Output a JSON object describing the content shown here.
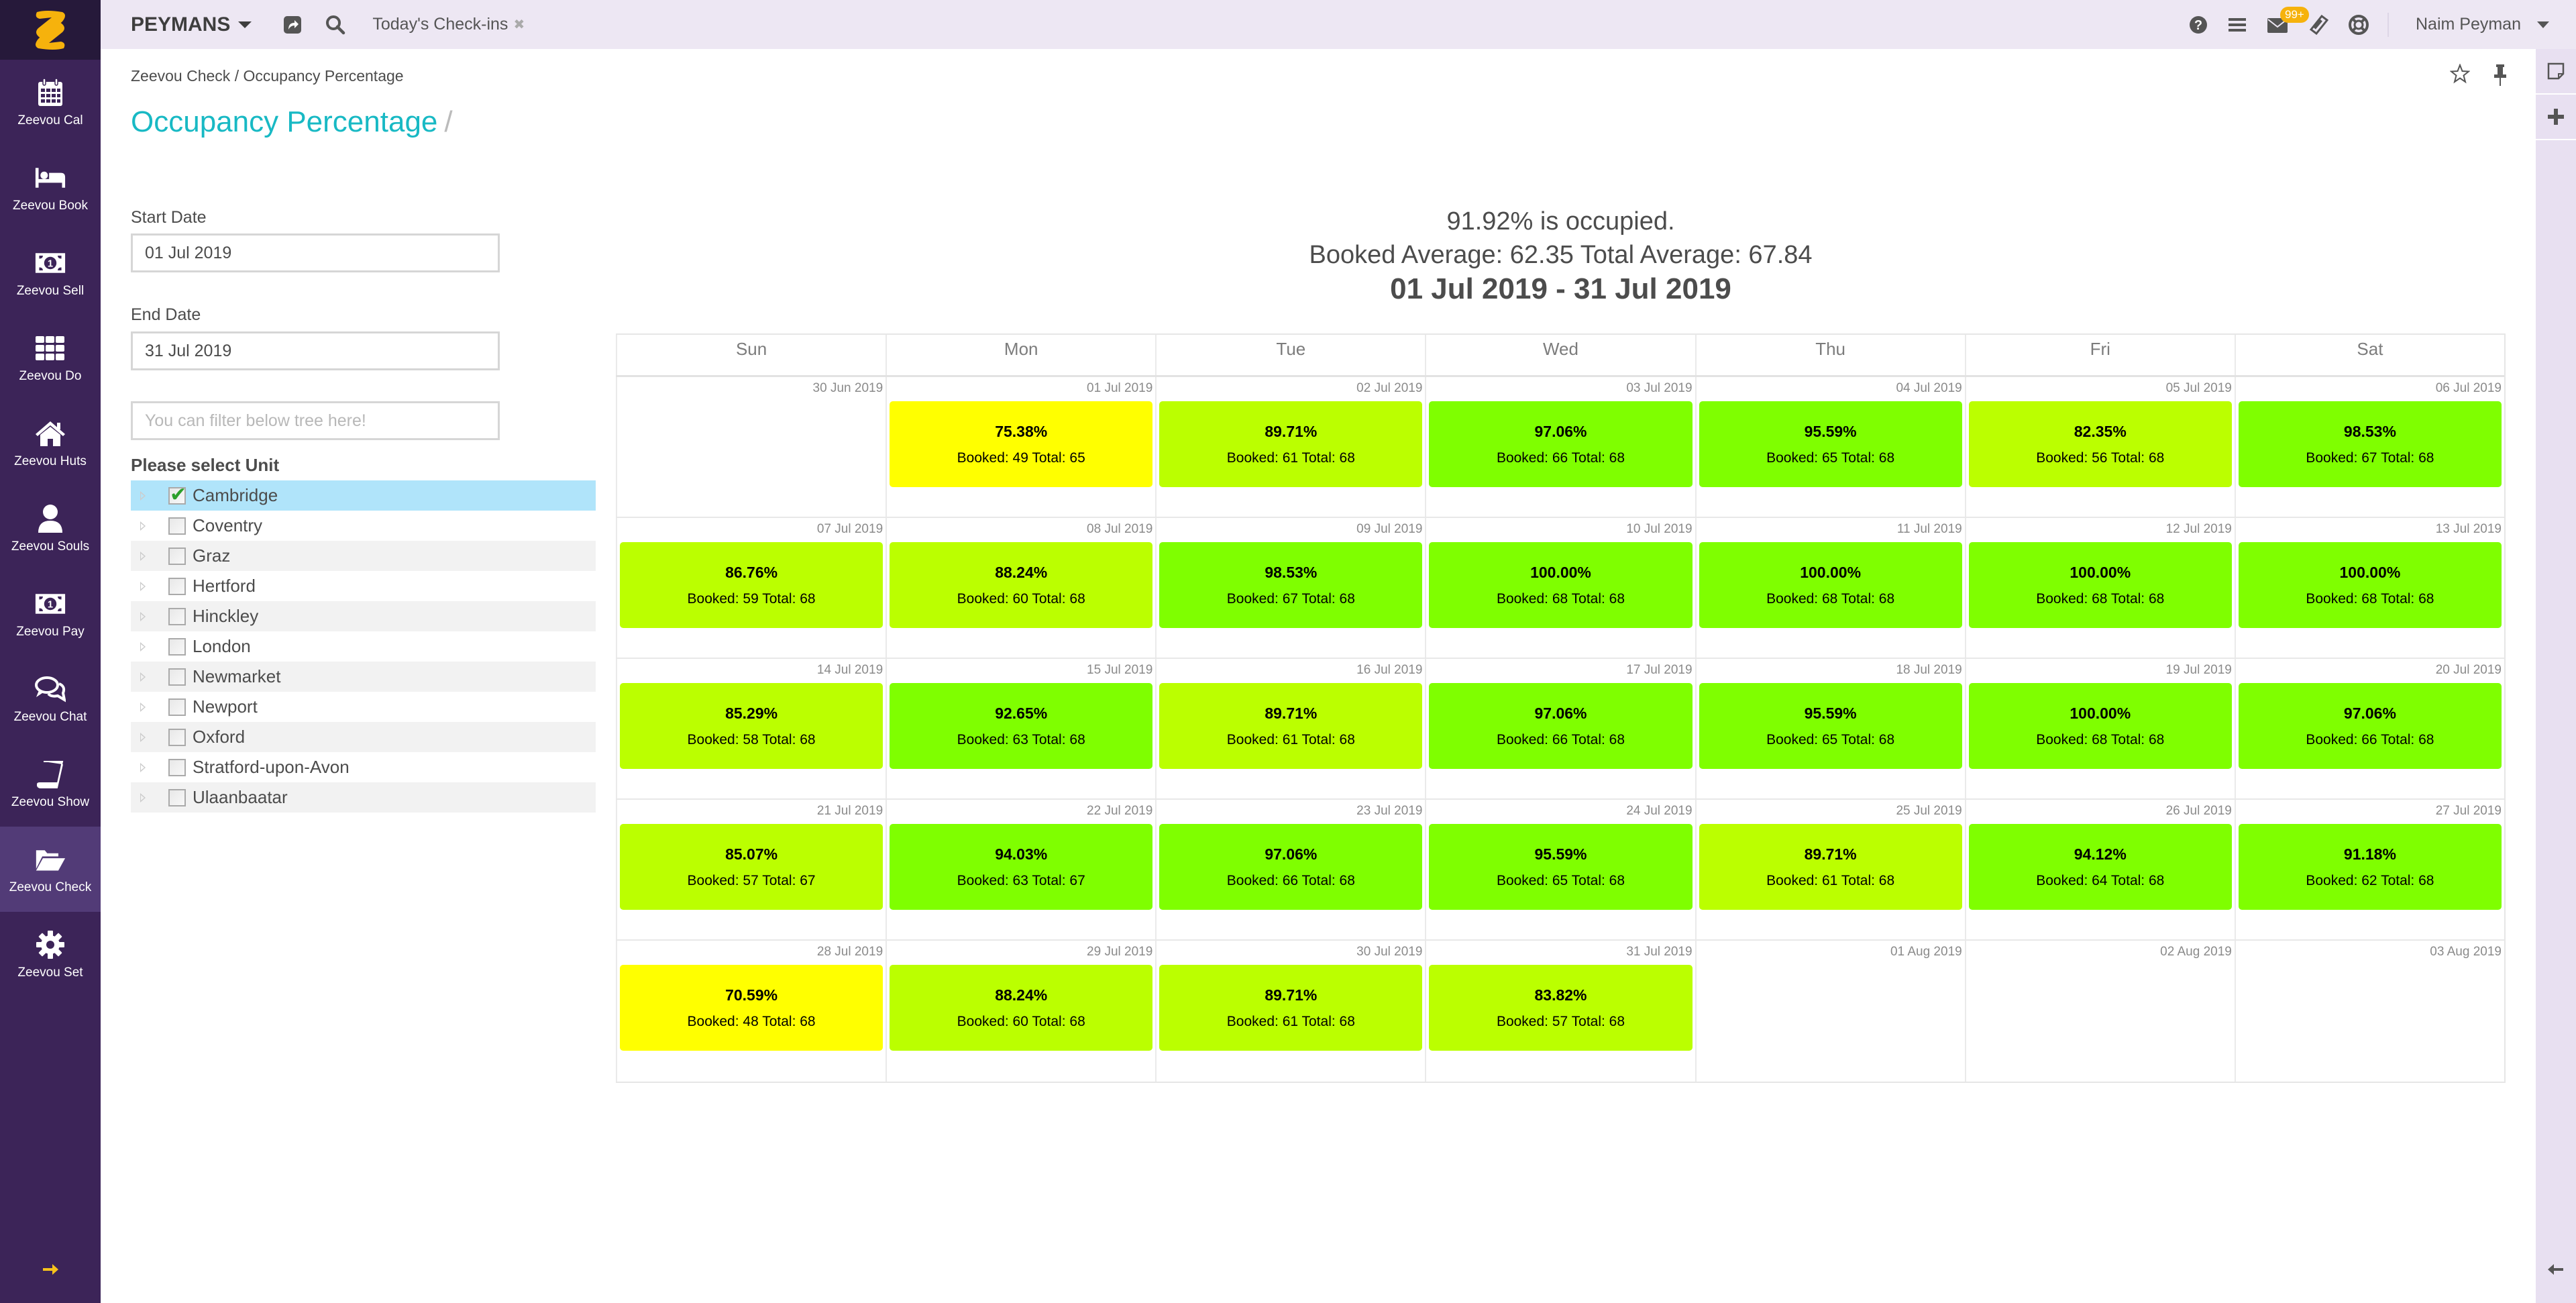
{
  "app": {
    "company": "PEYMANS",
    "quick_filter": "Today's Check-ins",
    "user_name": "Naim Peyman",
    "message_badge": "99+"
  },
  "sidebar": {
    "items": [
      {
        "label": "Zeevou Cal",
        "icon": "calendar-icon"
      },
      {
        "label": "Zeevou Book",
        "icon": "bed-icon"
      },
      {
        "label": "Zeevou Sell",
        "icon": "money-icon"
      },
      {
        "label": "Zeevou Do",
        "icon": "grid-icon"
      },
      {
        "label": "Zeevou Huts",
        "icon": "home-icon"
      },
      {
        "label": "Zeevou Souls",
        "icon": "user-icon"
      },
      {
        "label": "Zeevou Pay",
        "icon": "money-icon"
      },
      {
        "label": "Zeevou Chat",
        "icon": "chat-icon"
      },
      {
        "label": "Zeevou Show",
        "icon": "book-icon"
      },
      {
        "label": "Zeevou Check",
        "icon": "folder-open-icon",
        "active": true
      },
      {
        "label": "Zeevou Set",
        "icon": "gear-icon"
      }
    ]
  },
  "breadcrumb": {
    "parent": "Zeevou Check",
    "separator": " / ",
    "current": "Occupancy Percentage"
  },
  "page": {
    "title": "Occupancy Percentage",
    "title_suffix": "/"
  },
  "filters": {
    "start_label": "Start Date",
    "start_value": "01 Jul 2019",
    "end_label": "End Date",
    "end_value": "31 Jul 2019",
    "tree_filter_placeholder": "You can filter below tree here!",
    "unit_title": "Please select Unit"
  },
  "units": [
    {
      "name": "Cambridge",
      "checked": true
    },
    {
      "name": "Coventry",
      "checked": false
    },
    {
      "name": "Graz",
      "checked": false
    },
    {
      "name": "Hertford",
      "checked": false
    },
    {
      "name": "Hinckley",
      "checked": false
    },
    {
      "name": "London",
      "checked": false
    },
    {
      "name": "Newmarket",
      "checked": false
    },
    {
      "name": "Newport",
      "checked": false
    },
    {
      "name": "Oxford",
      "checked": false
    },
    {
      "name": "Stratford-upon-Avon",
      "checked": false
    },
    {
      "name": "Ulaanbaatar",
      "checked": false
    }
  ],
  "summary": {
    "occupied": "91.92% is occupied.",
    "averages": "Booked Average: 62.35 Total Average: 67.84",
    "range": "01 Jul 2019 - 31 Jul 2019"
  },
  "colors": {
    "low": "#ffff00",
    "mid": "#bbff00",
    "high": "#7fff00",
    "title": "#18b9c4",
    "sidebar": "#3c2458",
    "accent": "#f6b20c"
  },
  "calendar": {
    "weekdays": [
      "Sun",
      "Mon",
      "Tue",
      "Wed",
      "Thu",
      "Fri",
      "Sat"
    ],
    "weeks": [
      [
        {
          "date": "30 Jun 2019"
        },
        {
          "date": "01 Jul 2019",
          "pct": "75.38%",
          "booked": 49,
          "total": 65,
          "level": "low"
        },
        {
          "date": "02 Jul 2019",
          "pct": "89.71%",
          "booked": 61,
          "total": 68,
          "level": "mid"
        },
        {
          "date": "03 Jul 2019",
          "pct": "97.06%",
          "booked": 66,
          "total": 68,
          "level": "high"
        },
        {
          "date": "04 Jul 2019",
          "pct": "95.59%",
          "booked": 65,
          "total": 68,
          "level": "high"
        },
        {
          "date": "05 Jul 2019",
          "pct": "82.35%",
          "booked": 56,
          "total": 68,
          "level": "mid"
        },
        {
          "date": "06 Jul 2019",
          "pct": "98.53%",
          "booked": 67,
          "total": 68,
          "level": "high"
        }
      ],
      [
        {
          "date": "07 Jul 2019",
          "pct": "86.76%",
          "booked": 59,
          "total": 68,
          "level": "mid"
        },
        {
          "date": "08 Jul 2019",
          "pct": "88.24%",
          "booked": 60,
          "total": 68,
          "level": "mid"
        },
        {
          "date": "09 Jul 2019",
          "pct": "98.53%",
          "booked": 67,
          "total": 68,
          "level": "high"
        },
        {
          "date": "10 Jul 2019",
          "pct": "100.00%",
          "booked": 68,
          "total": 68,
          "level": "high"
        },
        {
          "date": "11 Jul 2019",
          "pct": "100.00%",
          "booked": 68,
          "total": 68,
          "level": "high"
        },
        {
          "date": "12 Jul 2019",
          "pct": "100.00%",
          "booked": 68,
          "total": 68,
          "level": "high"
        },
        {
          "date": "13 Jul 2019",
          "pct": "100.00%",
          "booked": 68,
          "total": 68,
          "level": "high"
        }
      ],
      [
        {
          "date": "14 Jul 2019",
          "pct": "85.29%",
          "booked": 58,
          "total": 68,
          "level": "mid"
        },
        {
          "date": "15 Jul 2019",
          "pct": "92.65%",
          "booked": 63,
          "total": 68,
          "level": "high"
        },
        {
          "date": "16 Jul 2019",
          "pct": "89.71%",
          "booked": 61,
          "total": 68,
          "level": "mid"
        },
        {
          "date": "17 Jul 2019",
          "pct": "97.06%",
          "booked": 66,
          "total": 68,
          "level": "high"
        },
        {
          "date": "18 Jul 2019",
          "pct": "95.59%",
          "booked": 65,
          "total": 68,
          "level": "high"
        },
        {
          "date": "19 Jul 2019",
          "pct": "100.00%",
          "booked": 68,
          "total": 68,
          "level": "high"
        },
        {
          "date": "20 Jul 2019",
          "pct": "97.06%",
          "booked": 66,
          "total": 68,
          "level": "high"
        }
      ],
      [
        {
          "date": "21 Jul 2019",
          "pct": "85.07%",
          "booked": 57,
          "total": 67,
          "level": "mid"
        },
        {
          "date": "22 Jul 2019",
          "pct": "94.03%",
          "booked": 63,
          "total": 67,
          "level": "high"
        },
        {
          "date": "23 Jul 2019",
          "pct": "97.06%",
          "booked": 66,
          "total": 68,
          "level": "high"
        },
        {
          "date": "24 Jul 2019",
          "pct": "95.59%",
          "booked": 65,
          "total": 68,
          "level": "high"
        },
        {
          "date": "25 Jul 2019",
          "pct": "89.71%",
          "booked": 61,
          "total": 68,
          "level": "mid"
        },
        {
          "date": "26 Jul 2019",
          "pct": "94.12%",
          "booked": 64,
          "total": 68,
          "level": "high"
        },
        {
          "date": "27 Jul 2019",
          "pct": "91.18%",
          "booked": 62,
          "total": 68,
          "level": "high"
        }
      ],
      [
        {
          "date": "28 Jul 2019",
          "pct": "70.59%",
          "booked": 48,
          "total": 68,
          "level": "low"
        },
        {
          "date": "29 Jul 2019",
          "pct": "88.24%",
          "booked": 60,
          "total": 68,
          "level": "mid"
        },
        {
          "date": "30 Jul 2019",
          "pct": "89.71%",
          "booked": 61,
          "total": 68,
          "level": "mid"
        },
        {
          "date": "31 Jul 2019",
          "pct": "83.82%",
          "booked": 57,
          "total": 68,
          "level": "mid"
        },
        {
          "date": "01 Aug 2019"
        },
        {
          "date": "02 Aug 2019"
        },
        {
          "date": "03 Aug 2019"
        }
      ]
    ]
  }
}
